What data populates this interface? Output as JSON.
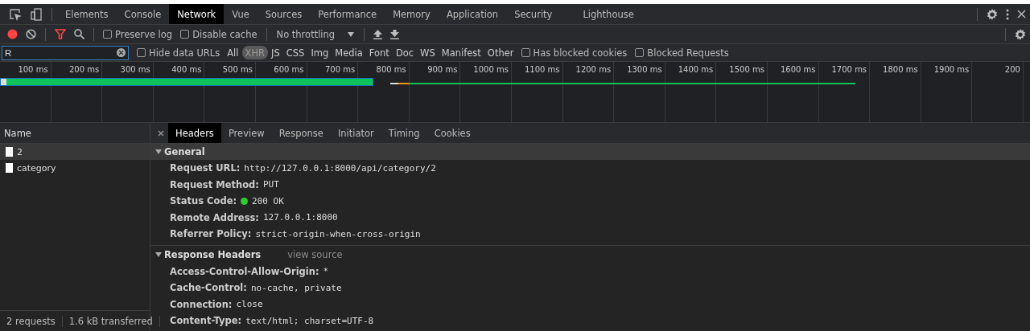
{
  "main_tabs": [
    {
      "label": "Elements",
      "selected": false
    },
    {
      "label": "Console",
      "selected": false
    },
    {
      "label": "Network",
      "selected": true
    },
    {
      "label": "Vue",
      "selected": false
    },
    {
      "label": "Sources",
      "selected": false
    },
    {
      "label": "Performance",
      "selected": false
    },
    {
      "label": "Memory",
      "selected": false
    },
    {
      "label": "Application",
      "selected": false
    },
    {
      "label": "Security",
      "selected": false
    },
    {
      "label": "Lighthouse",
      "selected": false
    }
  ],
  "toolbar": {
    "recording": true,
    "filter_active": true,
    "checkboxes": [
      {
        "label": "Preserve log",
        "checked": false
      },
      {
        "label": "Disable cache",
        "checked": false
      }
    ],
    "throttling": "No throttling"
  },
  "filter_bar": {
    "value": "R",
    "hide_data_urls": {
      "label": "Hide data URLs",
      "checked": false
    },
    "types": [
      {
        "label": "All",
        "selected": false
      },
      {
        "label": "XHR",
        "selected": true
      },
      {
        "label": "JS",
        "selected": false
      },
      {
        "label": "CSS",
        "selected": false
      },
      {
        "label": "Img",
        "selected": false
      },
      {
        "label": "Media",
        "selected": false
      },
      {
        "label": "Font",
        "selected": false
      },
      {
        "label": "Doc",
        "selected": false
      },
      {
        "label": "WS",
        "selected": false
      },
      {
        "label": "Manifest",
        "selected": false
      },
      {
        "label": "Other",
        "selected": false
      }
    ],
    "more_checkboxes": [
      {
        "label": "Has blocked cookies",
        "checked": false
      },
      {
        "label": "Blocked Requests",
        "checked": false
      }
    ]
  },
  "timeline": {
    "ticks": [
      "100 ms",
      "200 ms",
      "300 ms",
      "400 ms",
      "500 ms",
      "600 ms",
      "700 ms",
      "800 ms",
      "900 ms",
      "1000 ms",
      "1100 ms",
      "1200 ms",
      "1300 ms",
      "1400 ms",
      "1500 ms",
      "1600 ms",
      "1700 ms",
      "1800 ms",
      "1900 ms",
      "200"
    ]
  },
  "requests": {
    "column": "Name",
    "items": [
      {
        "name": "2",
        "selected": true
      },
      {
        "name": "category",
        "selected": false
      }
    ],
    "status": [
      "2 requests",
      "1.6 kB transferred"
    ]
  },
  "detail": {
    "tabs": [
      {
        "label": "Headers",
        "selected": true
      },
      {
        "label": "Preview",
        "selected": false
      },
      {
        "label": "Response",
        "selected": false
      },
      {
        "label": "Initiator",
        "selected": false
      },
      {
        "label": "Timing",
        "selected": false
      },
      {
        "label": "Cookies",
        "selected": false
      }
    ],
    "sections": [
      {
        "title": "General",
        "expanded": true,
        "rows": [
          {
            "key": "Request URL:",
            "value": "http://127.0.0.1:8000/api/category/2",
            "kind": "text"
          },
          {
            "key": "Request Method:",
            "value": "PUT",
            "kind": "text"
          },
          {
            "key": "Status Code:",
            "value": "200 OK",
            "kind": "status"
          },
          {
            "key": "Remote Address:",
            "value": "127.0.0.1:8000",
            "kind": "text"
          },
          {
            "key": "Referrer Policy:",
            "value": "strict-origin-when-cross-origin",
            "kind": "text"
          }
        ]
      },
      {
        "title": "Response Headers",
        "expanded": true,
        "link": "view source",
        "rows": [
          {
            "key": "Access-Control-Allow-Origin:",
            "value": "*",
            "kind": "text"
          },
          {
            "key": "Cache-Control:",
            "value": "no-cache, private",
            "kind": "text"
          },
          {
            "key": "Connection:",
            "value": "close",
            "kind": "text"
          },
          {
            "key": "Content-Type:",
            "value": "text/html; charset=UTF-8",
            "kind": "text"
          }
        ]
      }
    ]
  }
}
